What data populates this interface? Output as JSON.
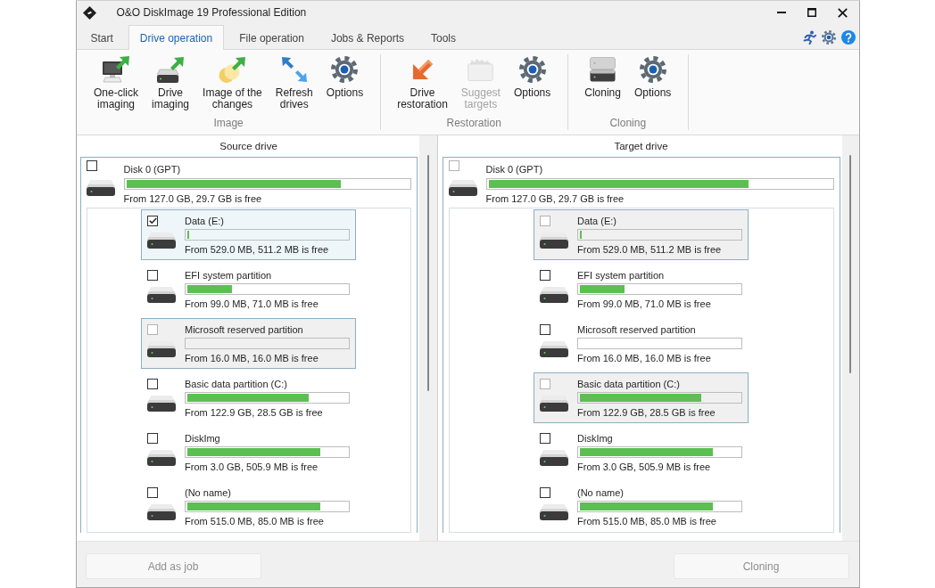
{
  "window": {
    "title": "O&O DiskImage 19 Professional Edition"
  },
  "tabs": [
    {
      "label": "Start",
      "selected": false
    },
    {
      "label": "Drive operation",
      "selected": true
    },
    {
      "label": "File operation",
      "selected": false
    },
    {
      "label": "Jobs & Reports",
      "selected": false
    },
    {
      "label": "Tools",
      "selected": false
    }
  ],
  "ribbon": {
    "groups": [
      {
        "label": "Image",
        "buttons": [
          {
            "label": "One-click\nimaging",
            "kind": "oneclick",
            "disabled": false
          },
          {
            "label": "Drive\nimaging",
            "kind": "imaging",
            "disabled": false
          },
          {
            "label": "Image of the\nchanges",
            "kind": "changes",
            "disabled": false
          },
          {
            "label": "Refresh\ndrives",
            "kind": "refresh",
            "disabled": false
          },
          {
            "label": "Options",
            "kind": "options",
            "disabled": false
          }
        ]
      },
      {
        "label": "Restoration",
        "buttons": [
          {
            "label": "Drive\nrestoration",
            "kind": "restore",
            "disabled": false
          },
          {
            "label": "Suggest\ntargets",
            "kind": "suggest",
            "disabled": true
          },
          {
            "label": "Options",
            "kind": "options",
            "disabled": false
          }
        ]
      },
      {
        "label": "Cloning",
        "buttons": [
          {
            "label": "Cloning",
            "kind": "clone",
            "disabled": false
          },
          {
            "label": "Options",
            "kind": "options",
            "disabled": false
          }
        ]
      }
    ]
  },
  "panels": [
    {
      "title": "Source drive",
      "disk": {
        "name": "Disk 0 (GPT)",
        "checked": false,
        "disabled": false,
        "level": 0.76,
        "info": "From 127.0 GB, 29.7 GB is free",
        "children": [
          {
            "name": "Data (E:)",
            "checked": true,
            "selected": true,
            "disabled": false,
            "level": 0.01,
            "info": "From 529.0 MB, 511.2 MB is free"
          },
          {
            "name": "EFI system partition",
            "checked": false,
            "selected": false,
            "disabled": false,
            "level": 0.28,
            "info": "From 99.0 MB, 71.0 MB is free"
          },
          {
            "name": "Microsoft reserved partition",
            "checked": false,
            "selected": false,
            "disabled": true,
            "level": 0,
            "info": "From 16.0 MB, 16.0 MB is free"
          },
          {
            "name": "Basic data partition (C:)",
            "checked": false,
            "selected": false,
            "disabled": false,
            "level": 0.76,
            "info": "From 122.9 GB, 28.5 GB is free"
          },
          {
            "name": "DiskImg",
            "checked": false,
            "selected": false,
            "disabled": false,
            "level": 0.83,
            "info": "From 3.0 GB, 505.9 MB is free"
          },
          {
            "name": "(No name)",
            "checked": false,
            "selected": false,
            "disabled": false,
            "level": 0.83,
            "info": "From 515.0 MB, 85.0 MB is free"
          }
        ]
      }
    },
    {
      "title": "Target drive",
      "disk": {
        "name": "Disk 0 (GPT)",
        "checked": false,
        "disabled": true,
        "level": 0.76,
        "info": "From 127.0 GB, 29.7 GB is free",
        "children": [
          {
            "name": "Data (E:)",
            "checked": false,
            "selected": false,
            "disabled": true,
            "level": 0.01,
            "info": "From 529.0 MB, 511.2 MB is free"
          },
          {
            "name": "EFI system partition",
            "checked": false,
            "selected": false,
            "disabled": false,
            "level": 0.28,
            "info": "From 99.0 MB, 71.0 MB is free"
          },
          {
            "name": "Microsoft reserved partition",
            "checked": false,
            "selected": false,
            "disabled": false,
            "level": 0,
            "info": "From 16.0 MB, 16.0 MB is free"
          },
          {
            "name": "Basic data partition (C:)",
            "checked": false,
            "selected": false,
            "disabled": true,
            "level": 0.76,
            "info": "From 122.9 GB, 28.5 GB is free"
          },
          {
            "name": "DiskImg",
            "checked": false,
            "selected": false,
            "disabled": false,
            "level": 0.83,
            "info": "From 3.0 GB, 505.9 MB is free"
          },
          {
            "name": "(No name)",
            "checked": false,
            "selected": false,
            "disabled": false,
            "level": 0.83,
            "info": "From 515.0 MB, 85.0 MB is free"
          }
        ]
      }
    }
  ],
  "buttons": [
    {
      "label": "Add as job",
      "disabled": true
    },
    {
      "label": "Cloning",
      "disabled": true
    }
  ]
}
